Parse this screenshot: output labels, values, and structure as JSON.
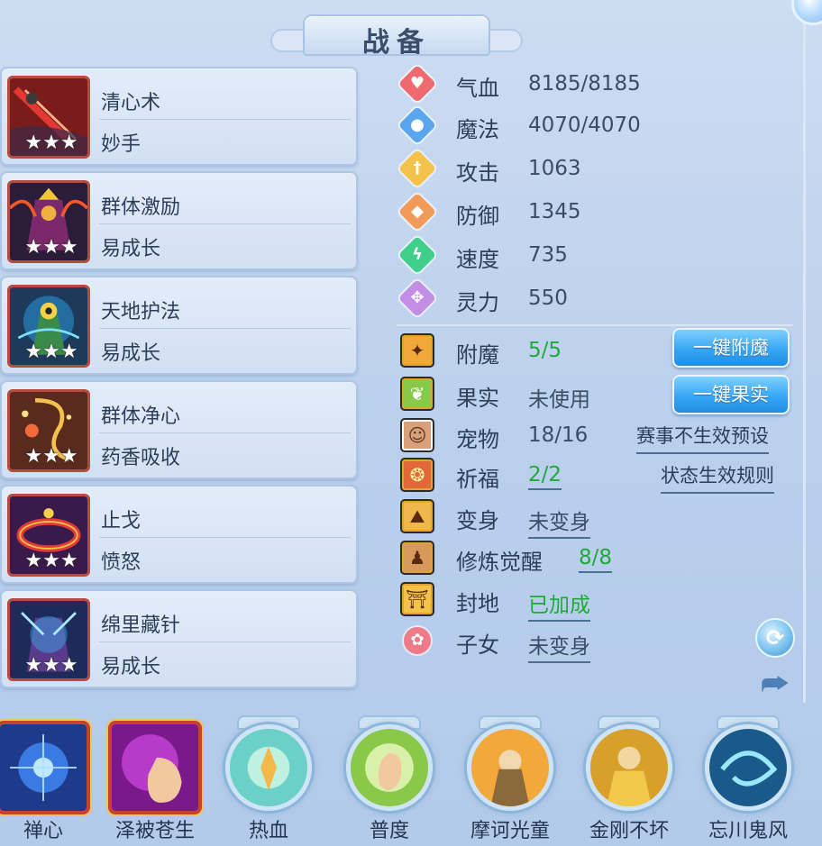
{
  "title": "战备",
  "skills": [
    {
      "name": "清心术",
      "sub": "妙手",
      "stars": "★★★"
    },
    {
      "name": "群体激励",
      "sub": "易成长",
      "stars": "★★★"
    },
    {
      "name": "天地护法",
      "sub": "易成长",
      "stars": "★★★"
    },
    {
      "name": "群体净心",
      "sub": "药香吸收",
      "stars": "★★★"
    },
    {
      "name": "止戈",
      "sub": "愤怒",
      "stars": "★★★"
    },
    {
      "name": "绵里藏针",
      "sub": "易成长",
      "stars": "★★★"
    }
  ],
  "stats": [
    {
      "label": "气血",
      "value": "8185/8185",
      "icon": "heart-icon",
      "color": "#ee6a6e"
    },
    {
      "label": "魔法",
      "value": "4070/4070",
      "icon": "mana-icon",
      "color": "#5aa6ee"
    },
    {
      "label": "攻击",
      "value": "1063",
      "icon": "sword-icon",
      "color": "#f2c24a"
    },
    {
      "label": "防御",
      "value": "1345",
      "icon": "shield-icon",
      "color": "#f29a5a"
    },
    {
      "label": "速度",
      "value": "735",
      "icon": "lightning-icon",
      "color": "#3fcf8a"
    },
    {
      "label": "灵力",
      "value": "550",
      "icon": "spirit-icon",
      "color": "#c58ee6"
    }
  ],
  "extras": [
    {
      "label": "附魔",
      "value": "5/5",
      "icon": "enchant-icon"
    },
    {
      "label": "果实",
      "value": "未使用",
      "icon": "fruit-icon"
    },
    {
      "label": "宠物",
      "value": "18/16",
      "icon": "pet-icon"
    },
    {
      "label": "祈福",
      "value": "2/2",
      "icon": "blessing-icon"
    },
    {
      "label": "变身",
      "value": "未变身",
      "icon": "transform-icon"
    },
    {
      "label": "修炼觉醒",
      "value": "8/8",
      "icon": "cultivation-icon"
    },
    {
      "label": "封地",
      "value": "已加成",
      "icon": "fief-icon"
    },
    {
      "label": "子女",
      "value": "未变身",
      "icon": "child-icon"
    }
  ],
  "buttons": {
    "enchant": "一键附魔",
    "fruit": "一键果实",
    "tournament": "赛事不生效预设",
    "rules": "状态生效规则"
  },
  "bottom_skills": [
    "禅心",
    "泽被苍生",
    "热血",
    "普度",
    "摩诃光童",
    "金刚不坏",
    "忘川鬼风"
  ],
  "colors": {
    "green": "#21a83a",
    "frame_red": "#c8402f",
    "button_blue": "#37a6f3"
  }
}
